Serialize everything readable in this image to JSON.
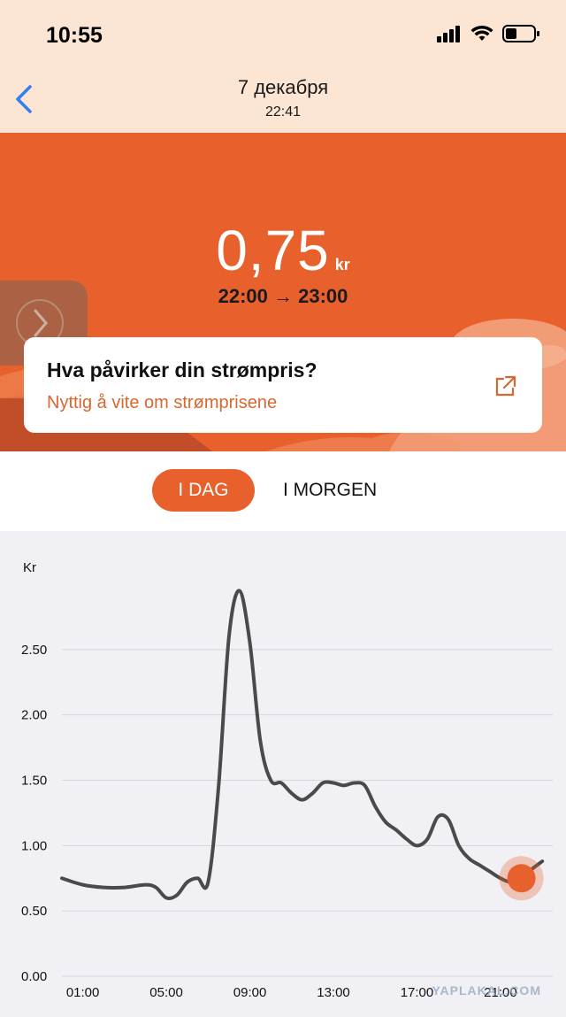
{
  "status": {
    "time": "10:55"
  },
  "nav": {
    "title": "7 декабря",
    "subtitle": "22:41"
  },
  "hero": {
    "price": "0,75",
    "unit": "kr",
    "range": "22:00 → 23:00"
  },
  "info_card": {
    "title": "Hva påvirker din strømpris?",
    "subtitle": "Nyttig å vite om strømprisene"
  },
  "tabs": {
    "today": "I DAG",
    "tomorrow": "I MORGEN",
    "active": "today"
  },
  "colors": {
    "accent": "#e8602c",
    "line": "#4a4a4a",
    "marker": "#e8602c"
  },
  "watermark": "YAPLAKAL.COM",
  "chart_data": {
    "type": "line",
    "ylabel": "Kr",
    "xlabel": "",
    "ylim": [
      0,
      3.0
    ],
    "yticks": [
      "0.00",
      "0.50",
      "1.00",
      "1.50",
      "2.00",
      "2.50"
    ],
    "ytick_values": [
      0,
      0.5,
      1.0,
      1.5,
      2.0,
      2.5
    ],
    "xticks": [
      "01:00",
      "05:00",
      "09:00",
      "13:00",
      "17:00",
      "21:00"
    ],
    "xtick_values": [
      1,
      5,
      9,
      13,
      17,
      21
    ],
    "xlim": [
      0,
      23.5
    ],
    "grid": true,
    "series": [
      {
        "x": [
          0,
          1,
          2,
          3,
          4,
          4.5,
          5,
          5.5,
          6,
          6.5,
          7,
          7.5,
          8,
          8.5,
          9,
          9.5,
          10,
          10.5,
          11,
          11.5,
          12,
          12.5,
          13,
          13.5,
          14,
          14.5,
          15,
          15.5,
          16,
          16.5,
          17,
          17.5,
          18,
          18.5,
          19,
          19.5,
          20,
          20.5,
          21,
          21.5,
          22,
          22.5,
          23
        ],
        "values": [
          0.75,
          0.7,
          0.68,
          0.68,
          0.7,
          0.68,
          0.6,
          0.62,
          0.72,
          0.75,
          0.72,
          1.45,
          2.6,
          2.95,
          2.55,
          1.8,
          1.5,
          1.48,
          1.4,
          1.35,
          1.4,
          1.48,
          1.48,
          1.46,
          1.48,
          1.46,
          1.3,
          1.18,
          1.12,
          1.05,
          1.0,
          1.05,
          1.22,
          1.2,
          1.0,
          0.9,
          0.85,
          0.8,
          0.75,
          0.72,
          0.75,
          0.82,
          0.88
        ]
      }
    ],
    "current_marker": {
      "x": 22,
      "value": 0.75
    }
  }
}
